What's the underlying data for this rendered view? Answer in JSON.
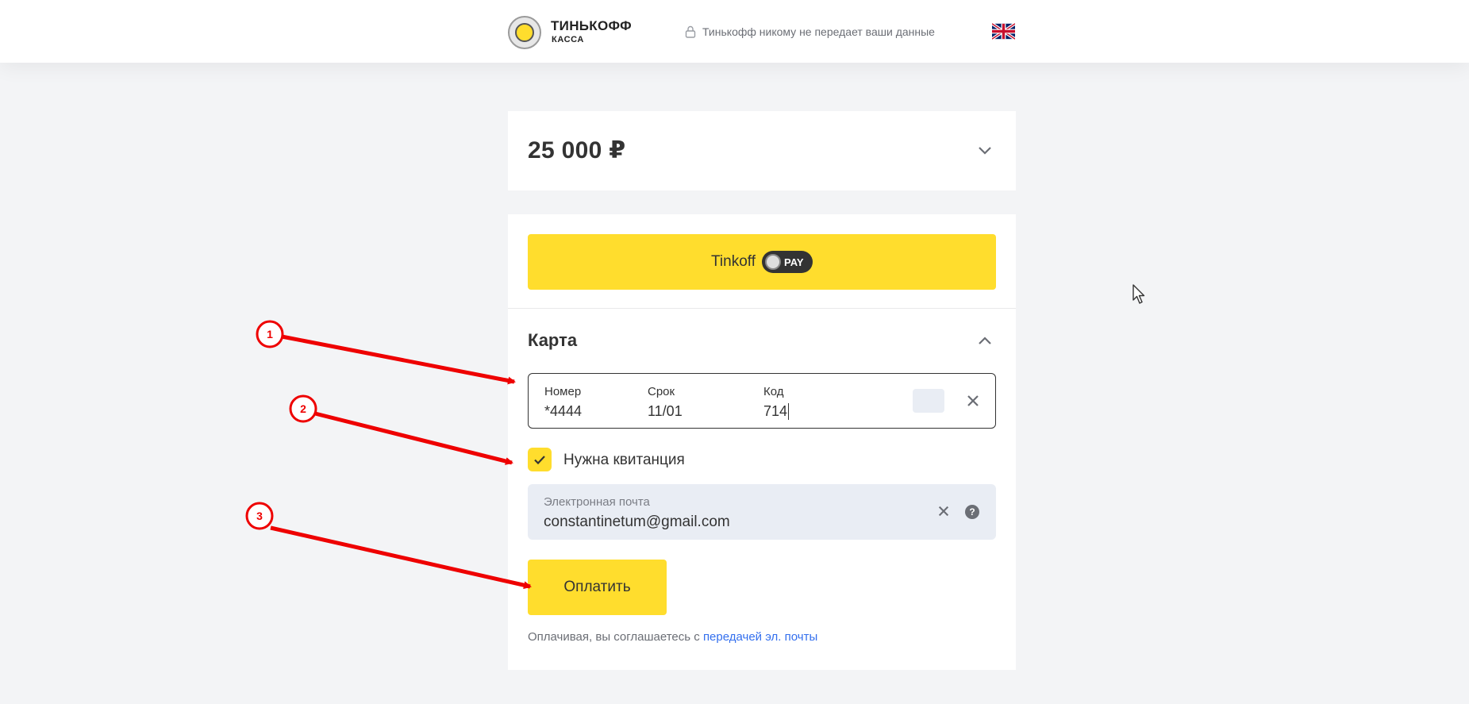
{
  "header": {
    "brand_title": "ТИНЬКОФФ",
    "brand_sub": "КАССА",
    "secure_text": "Тинькофф никому не передает ваши данные",
    "language_icon": "uk-flag-icon"
  },
  "amount": {
    "value": "25 000 ₽"
  },
  "tinkoff_pay": {
    "label": "Tinkoff",
    "badge": "PAY"
  },
  "card_section": {
    "title": "Карта",
    "number_label": "Номер",
    "number_value": "*4444",
    "expiry_label": "Срок",
    "expiry_value": "11/01",
    "cvc_label": "Код",
    "cvc_value": "714"
  },
  "receipt": {
    "checkbox_label": "Нужна квитанция",
    "checked": true,
    "email_label": "Электронная почта",
    "email_value": "constantinetum@gmail.com",
    "help": "?"
  },
  "submit": {
    "label": "Оплатить"
  },
  "agreement": {
    "text": "Оплачивая, вы соглашаетесь с ",
    "link": "передачей эл. почты"
  },
  "annotations": [
    "1",
    "2",
    "3"
  ],
  "colors": {
    "accent_yellow": "#ffdd2d",
    "link_blue": "#336fee",
    "annotation_red": "#ee0000",
    "background": "#f3f4f6"
  }
}
